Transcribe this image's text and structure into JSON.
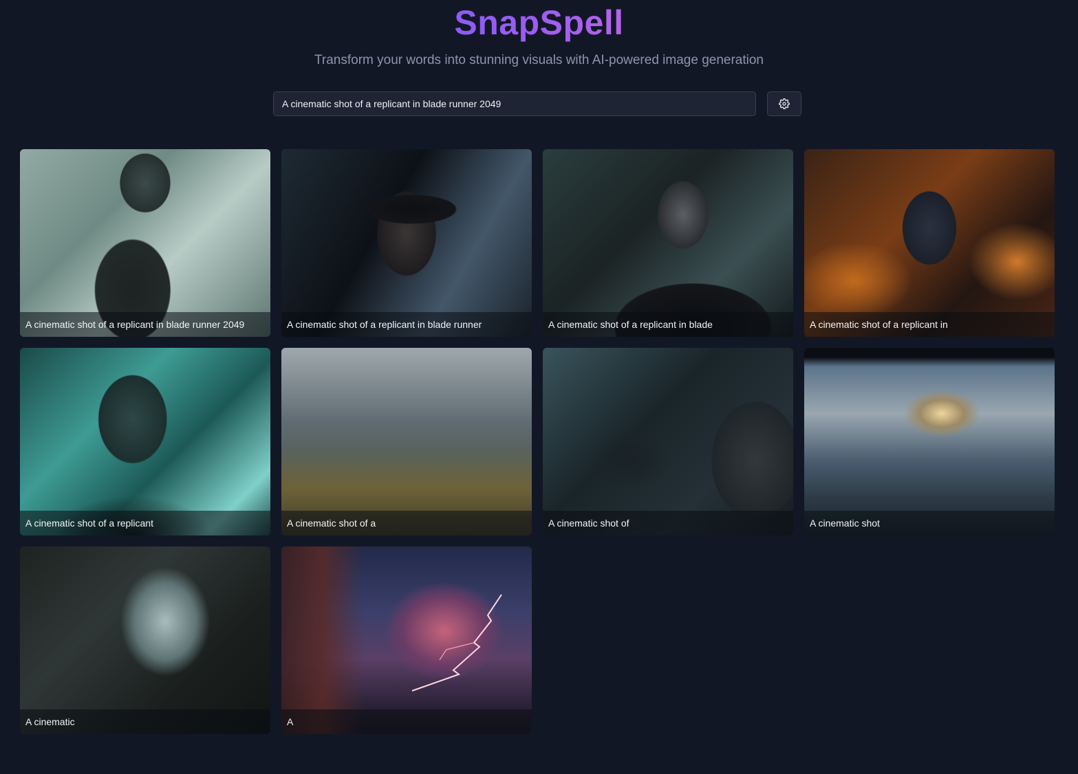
{
  "header": {
    "title": "SnapSpell",
    "subtitle": "Transform your words into stunning visuals with AI-powered image generation"
  },
  "search": {
    "value": "A cinematic shot of a replicant in blade runner 2049"
  },
  "settings": {
    "icon": "gear-icon"
  },
  "gallery": [
    {
      "caption": "A cinematic shot of a replicant in blade runner 2049"
    },
    {
      "caption": "A cinematic shot of a replicant in blade runner"
    },
    {
      "caption": "A cinematic shot of a replicant in blade"
    },
    {
      "caption": "A cinematic shot of a replicant in"
    },
    {
      "caption": "A cinematic shot of a replicant"
    },
    {
      "caption": "A cinematic shot of a"
    },
    {
      "caption": "A cinematic shot of"
    },
    {
      "caption": "A cinematic shot"
    },
    {
      "caption": "A cinematic"
    },
    {
      "caption": "A"
    }
  ],
  "colors": {
    "background": "#121726",
    "accent": "#8b5cf6",
    "input_bg": "#1e2433"
  }
}
